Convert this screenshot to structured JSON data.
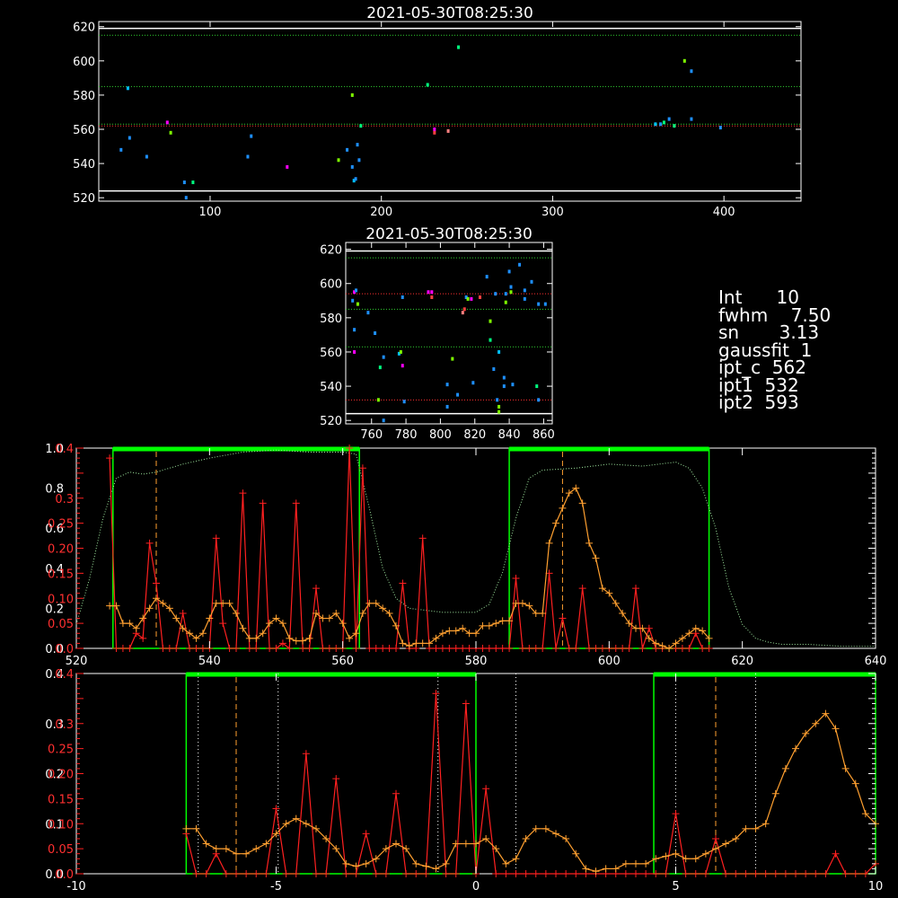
{
  "colors": {
    "bg": "#000000",
    "axis": "#ffffff",
    "green": "#00ff00",
    "red": "#ff2020",
    "orange": "#ffa030",
    "dot_green": "#30d030",
    "dot_red": "#ff3030"
  },
  "panel1": {
    "title": "2021-05-30T08:25:30",
    "xlim": [
      35,
      445
    ],
    "ylim": [
      518,
      623
    ],
    "xticks": [
      100,
      200,
      300,
      400
    ],
    "yticks": [
      520,
      540,
      560,
      580,
      600,
      620
    ],
    "hlines_green": [
      615,
      585,
      563
    ],
    "hlines_red": [
      562
    ],
    "hlines_white": [
      619,
      524
    ],
    "points": [
      [
        48,
        548,
        "#1e90ff"
      ],
      [
        53,
        555,
        "#1e90ff"
      ],
      [
        52,
        584,
        "#00bfff"
      ],
      [
        63,
        544,
        "#1e90ff"
      ],
      [
        75,
        564,
        "#ff00ff"
      ],
      [
        77,
        558,
        "#7fff00"
      ],
      [
        85,
        529,
        "#1e90ff"
      ],
      [
        86,
        520,
        "#1e90ff"
      ],
      [
        90,
        529,
        "#00ff7f"
      ],
      [
        122,
        544,
        "#1e90ff"
      ],
      [
        124,
        556,
        "#1e90ff"
      ],
      [
        145,
        538,
        "#ff00ff"
      ],
      [
        175,
        542,
        "#7fff00"
      ],
      [
        180,
        548,
        "#1e90ff"
      ],
      [
        183,
        538,
        "#1e90ff"
      ],
      [
        183,
        580,
        "#7fff00"
      ],
      [
        184,
        530,
        "#00bfff"
      ],
      [
        185,
        531,
        "#1e90ff"
      ],
      [
        186,
        551,
        "#1e90ff"
      ],
      [
        187,
        542,
        "#1e90ff"
      ],
      [
        188,
        562,
        "#00ff7f"
      ],
      [
        231,
        560,
        "#ff00ff"
      ],
      [
        231,
        558,
        "#ff4040"
      ],
      [
        227,
        586,
        "#00ff7f"
      ],
      [
        239,
        559,
        "#ff8080"
      ],
      [
        245,
        608,
        "#00ff7f"
      ],
      [
        360,
        563,
        "#00bfff"
      ],
      [
        363,
        563,
        "#1e90ff"
      ],
      [
        365,
        564,
        "#00ff7f"
      ],
      [
        368,
        566,
        "#1e90ff"
      ],
      [
        371,
        562,
        "#00ff7f"
      ],
      [
        377,
        600,
        "#7fff00"
      ],
      [
        381,
        566,
        "#1e90ff"
      ],
      [
        381,
        594,
        "#1e90ff"
      ],
      [
        398,
        561,
        "#1e90ff"
      ]
    ]
  },
  "panel2": {
    "title": "2021-05-30T08:25:30",
    "xlim": [
      745,
      865
    ],
    "ylim": [
      518,
      624
    ],
    "xticks": [
      760,
      780,
      800,
      820,
      840,
      860
    ],
    "yticks": [
      520,
      540,
      560,
      580,
      600,
      620
    ],
    "hlines_green": [
      615,
      585,
      563
    ],
    "hlines_red": [
      594,
      532
    ],
    "hlines_white": [
      619,
      524
    ],
    "points": [
      [
        749,
        590,
        "#1e90ff"
      ],
      [
        750,
        595,
        "#ff00ff"
      ],
      [
        751,
        596,
        "#1e90ff"
      ],
      [
        752,
        588,
        "#7fff00"
      ],
      [
        750,
        573,
        "#1e90ff"
      ],
      [
        750,
        560,
        "#ff00ff"
      ],
      [
        762,
        571,
        "#1e90ff"
      ],
      [
        758,
        583,
        "#1e90ff"
      ],
      [
        764,
        532,
        "#7fff00"
      ],
      [
        767,
        520,
        "#1e90ff"
      ],
      [
        765,
        551,
        "#00ff7f"
      ],
      [
        767,
        557,
        "#1e90ff"
      ],
      [
        776,
        559,
        "#00bfff"
      ],
      [
        777,
        560,
        "#7fff00"
      ],
      [
        778,
        552,
        "#ff00ff"
      ],
      [
        779,
        531,
        "#1e90ff"
      ],
      [
        778,
        592,
        "#1e90ff"
      ],
      [
        793,
        595,
        "#ff00ff"
      ],
      [
        795,
        595,
        "#ff00ff"
      ],
      [
        795,
        592,
        "#ff4040"
      ],
      [
        804,
        541,
        "#1e90ff"
      ],
      [
        804,
        528,
        "#1e90ff"
      ],
      [
        807,
        556,
        "#7fff00"
      ],
      [
        810,
        535,
        "#1e90ff"
      ],
      [
        813,
        583,
        "#ff8080"
      ],
      [
        814,
        585,
        "#ff4040"
      ],
      [
        815,
        592,
        "#1e90ff"
      ],
      [
        816,
        591,
        "#7fff00"
      ],
      [
        818,
        591,
        "#ff00ff"
      ],
      [
        819,
        542,
        "#1e90ff"
      ],
      [
        823,
        592,
        "#ff4040"
      ],
      [
        827,
        604,
        "#1e90ff"
      ],
      [
        829,
        578,
        "#7fff00"
      ],
      [
        829,
        567,
        "#00ff7f"
      ],
      [
        831,
        550,
        "#1e90ff"
      ],
      [
        832,
        594,
        "#1e90ff"
      ],
      [
        833,
        532,
        "#1e90ff"
      ],
      [
        834,
        528,
        "#7fff00"
      ],
      [
        834,
        525,
        "#7fff00"
      ],
      [
        834,
        560,
        "#00bfff"
      ],
      [
        837,
        540,
        "#1e90ff"
      ],
      [
        837,
        545,
        "#1e90ff"
      ],
      [
        838,
        589,
        "#7fff00"
      ],
      [
        838,
        594,
        "#1e90ff"
      ],
      [
        840,
        607,
        "#1e90ff"
      ],
      [
        841,
        598,
        "#1e90ff"
      ],
      [
        841,
        595,
        "#7fff00"
      ],
      [
        842,
        541,
        "#1e90ff"
      ],
      [
        846,
        611,
        "#1e90ff"
      ],
      [
        849,
        591,
        "#1e90ff"
      ],
      [
        849,
        596,
        "#1e90ff"
      ],
      [
        853,
        601,
        "#1e90ff"
      ],
      [
        856,
        540,
        "#00ff7f"
      ],
      [
        861,
        588,
        "#1e90ff"
      ],
      [
        857,
        588,
        "#1e90ff"
      ],
      [
        857,
        532,
        "#1e90ff"
      ]
    ]
  },
  "info": {
    "lines": [
      "Int      10",
      "fwhm    7.50",
      "sn       3.13",
      "gaussfit  1",
      "ipt_c  562",
      "ipt1  532",
      "ipt2  593"
    ]
  },
  "chart_data": [
    {
      "type": "line",
      "xlim": [
        520,
        640
      ],
      "xticks": [
        520,
        540,
        560,
        580,
        600,
        620,
        640
      ],
      "yticks_left_white": [
        "0.0",
        "0.2",
        "0.4",
        "0.6",
        "0.8",
        "1.0"
      ],
      "yticks_left_red": [
        "0.0",
        "0.05",
        "0.10",
        "0.15",
        "0.20",
        "0.25",
        "0.3",
        "0.4"
      ],
      "green_boxes": [
        [
          525.5,
          562.5
        ],
        [
          585,
          615
        ]
      ],
      "vlines_orange": [
        532,
        593
      ],
      "red_series": {
        "x": [
          525,
          526,
          527,
          528,
          529,
          530,
          531,
          532,
          533,
          534,
          535,
          536,
          537,
          538,
          539,
          540,
          541,
          542,
          543,
          544,
          545,
          546,
          547,
          548,
          549,
          550,
          551,
          552,
          553,
          554,
          555,
          556,
          557,
          558,
          559,
          560,
          561,
          562,
          563,
          564,
          565,
          566,
          567,
          568,
          569,
          570,
          571,
          572,
          573,
          574,
          575,
          576,
          577,
          578,
          579,
          580,
          581,
          582,
          583,
          584,
          585,
          586,
          587,
          588,
          589,
          590,
          591,
          592,
          593,
          594,
          595,
          596,
          597,
          598,
          599,
          600,
          601,
          602,
          603,
          604,
          605,
          606,
          607,
          608,
          609,
          610,
          611,
          612,
          613,
          614,
          615
        ],
        "y": [
          0.38,
          0.0,
          0.0,
          0.0,
          0.03,
          0.02,
          0.21,
          0.13,
          0.0,
          0.0,
          0.0,
          0.07,
          0.0,
          0.0,
          0.0,
          0.0,
          0.22,
          0.05,
          0.0,
          0.0,
          0.31,
          0.0,
          0.0,
          0.29,
          0.0,
          0.0,
          0.01,
          0.0,
          0.29,
          0.0,
          0.0,
          0.12,
          0.0,
          0.0,
          0.0,
          0.0,
          0.4,
          0.0,
          0.36,
          0.0,
          0.0,
          0.0,
          0.0,
          0.0,
          0.13,
          0.0,
          0.0,
          0.22,
          0.0,
          0.0,
          0.0,
          0.0,
          0.0,
          0.0,
          0.0,
          0.0,
          0.0,
          0.0,
          0.0,
          0.0,
          0.0,
          0.14,
          0.0,
          0.0,
          0.0,
          0.0,
          0.15,
          0.0,
          0.06,
          0.0,
          0.0,
          0.12,
          0.0,
          0.0,
          0.0,
          0.0,
          0.0,
          0.0,
          0.0,
          0.12,
          0.0,
          0.04,
          0.0,
          0.0,
          0.0,
          0.0,
          0.0,
          0.0,
          0.03,
          0.0,
          0.0
        ]
      },
      "orange_series": {
        "x": [
          525,
          526,
          527,
          528,
          529,
          530,
          531,
          532,
          533,
          534,
          535,
          536,
          537,
          538,
          539,
          540,
          541,
          542,
          543,
          544,
          545,
          546,
          547,
          548,
          549,
          550,
          551,
          552,
          553,
          554,
          555,
          556,
          557,
          558,
          559,
          560,
          561,
          562,
          563,
          564,
          565,
          566,
          567,
          568,
          569,
          570,
          571,
          572,
          573,
          574,
          575,
          576,
          577,
          578,
          579,
          580,
          581,
          582,
          583,
          584,
          585,
          586,
          587,
          588,
          589,
          590,
          591,
          592,
          593,
          594,
          595,
          596,
          597,
          598,
          599,
          600,
          601,
          602,
          603,
          604,
          605,
          606,
          607,
          608,
          609,
          610,
          611,
          612,
          613,
          614,
          615
        ],
        "y": [
          0.085,
          0.085,
          0.05,
          0.05,
          0.04,
          0.06,
          0.08,
          0.1,
          0.09,
          0.08,
          0.06,
          0.04,
          0.03,
          0.02,
          0.03,
          0.06,
          0.09,
          0.09,
          0.09,
          0.07,
          0.04,
          0.02,
          0.02,
          0.03,
          0.05,
          0.06,
          0.05,
          0.02,
          0.015,
          0.015,
          0.02,
          0.07,
          0.06,
          0.06,
          0.07,
          0.05,
          0.02,
          0.03,
          0.07,
          0.09,
          0.09,
          0.08,
          0.07,
          0.045,
          0.01,
          0.005,
          0.01,
          0.01,
          0.01,
          0.02,
          0.03,
          0.035,
          0.035,
          0.04,
          0.03,
          0.03,
          0.045,
          0.045,
          0.05,
          0.055,
          0.055,
          0.09,
          0.09,
          0.085,
          0.07,
          0.07,
          0.21,
          0.25,
          0.28,
          0.31,
          0.32,
          0.29,
          0.21,
          0.18,
          0.12,
          0.11,
          0.09,
          0.07,
          0.05,
          0.04,
          0.04,
          0.02,
          0.01,
          0.005,
          0.0,
          0.01,
          0.02,
          0.03,
          0.04,
          0.035,
          0.02
        ]
      },
      "dotted_profile": {
        "x": [
          520,
          522,
          524,
          526,
          528,
          530,
          532,
          536,
          540,
          545,
          550,
          555,
          560,
          562,
          564,
          566,
          568,
          570,
          575,
          580,
          582,
          584,
          586,
          588,
          590,
          595,
          600,
          605,
          610,
          612,
          614,
          616,
          618,
          620,
          622,
          624,
          626,
          630,
          635,
          640
        ],
        "y": [
          0.12,
          0.35,
          0.65,
          0.85,
          0.88,
          0.87,
          0.88,
          0.92,
          0.95,
          0.98,
          0.99,
          0.98,
          0.98,
          0.97,
          0.7,
          0.4,
          0.25,
          0.2,
          0.18,
          0.18,
          0.22,
          0.38,
          0.65,
          0.85,
          0.89,
          0.9,
          0.92,
          0.91,
          0.93,
          0.9,
          0.8,
          0.6,
          0.3,
          0.12,
          0.05,
          0.03,
          0.02,
          0.02,
          0.01,
          0.01
        ]
      }
    },
    {
      "type": "line",
      "xlim": [
        -10,
        10
      ],
      "xticks": [
        -10,
        -5,
        0,
        5,
        10
      ],
      "yticks_left_white": [
        "0.0",
        "0.1",
        "0.2",
        "0.3",
        "0.4"
      ],
      "yticks_left_red": [
        "0.0",
        "0.05",
        "0.10",
        "0.15",
        "0.20",
        "0.25",
        "0.3",
        "0.4"
      ],
      "green_boxes": [
        [
          -7.25,
          0.0
        ],
        [
          4.45,
          10.0
        ]
      ],
      "vlines_orange": [
        -6.0,
        6.0
      ],
      "vlines_dotted_white": [
        -6.95,
        -4.95,
        -0.95,
        1.0,
        5.0,
        7.0
      ],
      "red_series": {
        "x": [
          -7.25,
          -7.0,
          -6.75,
          -6.5,
          -6.25,
          -6.0,
          -5.75,
          -5.5,
          -5.25,
          -5.0,
          -4.75,
          -4.5,
          -4.25,
          -4.0,
          -3.75,
          -3.5,
          -3.25,
          -3.0,
          -2.75,
          -2.5,
          -2.25,
          -2.0,
          -1.75,
          -1.5,
          -1.25,
          -1.0,
          -0.75,
          -0.5,
          -0.25,
          0.0,
          0.25,
          0.5,
          0.75,
          1.0,
          1.25,
          1.5,
          1.75,
          2.0,
          2.25,
          2.5,
          2.75,
          3.0,
          3.25,
          3.5,
          3.75,
          4.0,
          4.25,
          4.5,
          4.75,
          5.0,
          5.25,
          5.5,
          5.75,
          6.0,
          6.25,
          6.5,
          6.75,
          7.0,
          7.25,
          7.5,
          7.75,
          8.0,
          8.25,
          8.5,
          8.75,
          9.0,
          9.25,
          9.5,
          9.75,
          10.0
        ],
        "y": [
          0.08,
          0.0,
          0.0,
          0.04,
          0.0,
          0.0,
          0.0,
          0.0,
          0.0,
          0.13,
          0.0,
          0.0,
          0.24,
          0.0,
          0.0,
          0.19,
          0.0,
          0.0,
          0.08,
          0.0,
          0.0,
          0.16,
          0.0,
          0.0,
          0.0,
          0.36,
          0.0,
          0.0,
          0.34,
          0.0,
          0.17,
          0.0,
          0.0,
          0.0,
          0.0,
          0.0,
          0.0,
          0.0,
          0.0,
          0.0,
          0.0,
          0.0,
          0.0,
          0.0,
          0.0,
          0.0,
          0.0,
          0.0,
          0.0,
          0.12,
          0.0,
          0.0,
          0.0,
          0.07,
          0.0,
          0.0,
          0.0,
          0.0,
          0.0,
          0.0,
          0.0,
          0.0,
          0.0,
          0.0,
          0.0,
          0.04,
          0.0,
          0.0,
          0.0,
          0.02
        ]
      },
      "orange_series": {
        "x": [
          -7.25,
          -7.0,
          -6.75,
          -6.5,
          -6.25,
          -6.0,
          -5.75,
          -5.5,
          -5.25,
          -5.0,
          -4.75,
          -4.5,
          -4.25,
          -4.0,
          -3.75,
          -3.5,
          -3.25,
          -3.0,
          -2.75,
          -2.5,
          -2.25,
          -2.0,
          -1.75,
          -1.5,
          -1.25,
          -1.0,
          -0.75,
          -0.5,
          -0.25,
          0.0,
          0.25,
          0.5,
          0.75,
          1.0,
          1.25,
          1.5,
          1.75,
          2.0,
          2.25,
          2.5,
          2.75,
          3.0,
          3.25,
          3.5,
          3.75,
          4.0,
          4.25,
          4.5,
          4.75,
          5.0,
          5.25,
          5.5,
          5.75,
          6.0,
          6.25,
          6.5,
          6.75,
          7.0,
          7.25,
          7.5,
          7.75,
          8.0,
          8.25,
          8.5,
          8.75,
          9.0,
          9.25,
          9.5,
          9.75,
          10.0
        ],
        "y": [
          0.09,
          0.09,
          0.06,
          0.05,
          0.05,
          0.04,
          0.04,
          0.05,
          0.06,
          0.08,
          0.1,
          0.11,
          0.1,
          0.09,
          0.07,
          0.05,
          0.02,
          0.015,
          0.02,
          0.03,
          0.05,
          0.06,
          0.05,
          0.02,
          0.015,
          0.01,
          0.02,
          0.06,
          0.06,
          0.06,
          0.07,
          0.05,
          0.02,
          0.03,
          0.07,
          0.09,
          0.09,
          0.08,
          0.07,
          0.04,
          0.01,
          0.005,
          0.01,
          0.01,
          0.02,
          0.02,
          0.02,
          0.03,
          0.035,
          0.04,
          0.03,
          0.03,
          0.04,
          0.05,
          0.06,
          0.07,
          0.09,
          0.09,
          0.1,
          0.16,
          0.21,
          0.25,
          0.28,
          0.3,
          0.32,
          0.29,
          0.21,
          0.18,
          0.12,
          0.1
        ]
      }
    }
  ]
}
